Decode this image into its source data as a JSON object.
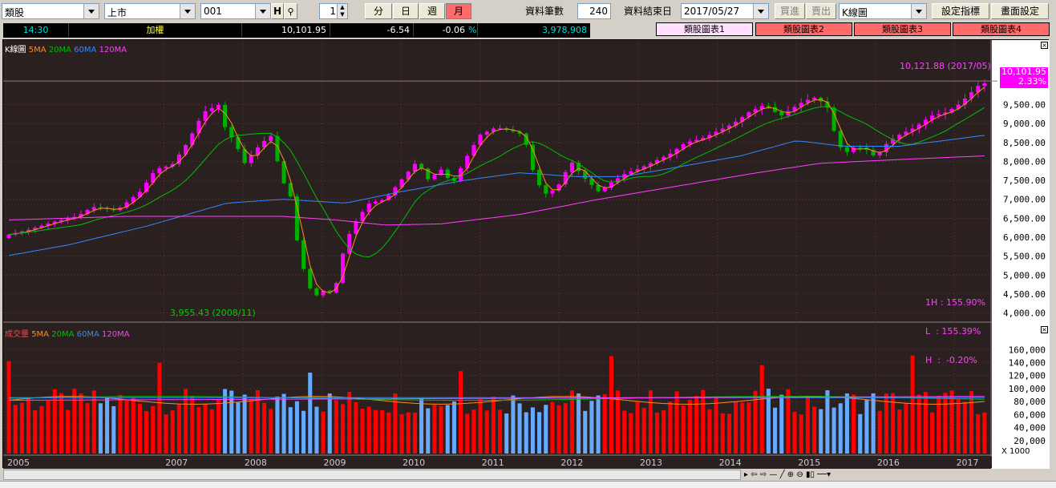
{
  "toolbar": {
    "category": "類股",
    "market": "上市",
    "code": "001",
    "h_btn": "H",
    "count": "1",
    "period_min": "分",
    "period_day": "日",
    "period_week": "週",
    "period_month": "月",
    "records_label": "資料筆數",
    "records_value": "240",
    "enddate_label": "資料結束日",
    "enddate_value": "2017/05/27",
    "buy_btn": "買進",
    "sell_btn": "賣出",
    "chart_type": "K線圖",
    "indicator_btn": "設定指標",
    "screen_btn": "畫面設定"
  },
  "quote": {
    "time": "14:30",
    "name": "加權",
    "price": "10,101.95",
    "change": "-6.54",
    "pct": "-0.06",
    "pct_sign": "%",
    "volume": "3,978,908"
  },
  "tabs": [
    "類股圖表1",
    "類股圖表2",
    "類股圖表3",
    "類股圖表4"
  ],
  "colors": {
    "up": "#ff00ff",
    "down": "#00b000",
    "ma5": "#ff8c1a",
    "ma20": "#00c000",
    "ma60": "#3388ff",
    "ma120": "#ff40ff",
    "vol_up": "#ff0000",
    "vol_down": "#66aaff"
  },
  "price_panel": {
    "legend": [
      "K線圖",
      "5MA",
      "20MA",
      "60MA",
      "120MA"
    ],
    "high_annot": "10,121.88 (2017/05)",
    "low_annot": "3,955.43 (2008/11)",
    "last_box": "10,101.95",
    "last_pct": "2.33%",
    "stats": [
      "1H : 155.90%",
      "L  : 155.39%",
      "H  :  -0.20%"
    ]
  },
  "volume_panel": {
    "legend": [
      "成交量",
      "5MA",
      "20MA",
      "60MA",
      "120MA"
    ],
    "unit": "X 1000"
  },
  "chart_data": {
    "type": "candlestick",
    "price_yticks": [
      4000,
      4500,
      5000,
      5500,
      6000,
      6500,
      7000,
      7500,
      8000,
      8500,
      9000,
      9500
    ],
    "price_ylim": [
      3800,
      10400
    ],
    "volume_yticks": [
      20000,
      40000,
      60000,
      80000,
      100000,
      120000,
      140000,
      160000
    ],
    "volume_ylim": [
      0,
      190000
    ],
    "x_years": [
      "2005",
      "2007",
      "2008",
      "2009",
      "2010",
      "2011",
      "2012",
      "2013",
      "2014",
      "2015",
      "2016",
      "2017"
    ],
    "year_x": [
      2005,
      2007,
      2008,
      2009,
      2010,
      2011,
      2012,
      2013,
      2014,
      2015,
      2016,
      2017
    ],
    "time_start": 2005.0,
    "time_end": 2017.42,
    "close_anchors": [
      [
        2005,
        6050
      ],
      [
        2005.3,
        6200
      ],
      [
        2005.6,
        6400
      ],
      [
        2005.9,
        6550
      ],
      [
        2006.1,
        6800
      ],
      [
        2006.4,
        6700
      ],
      [
        2006.7,
        7200
      ],
      [
        2006.9,
        7800
      ],
      [
        2007.1,
        7900
      ],
      [
        2007.3,
        8500
      ],
      [
        2007.5,
        9300
      ],
      [
        2007.7,
        9500
      ],
      [
        2007.8,
        8700
      ],
      [
        2007.9,
        8600
      ],
      [
        2008.0,
        7900
      ],
      [
        2008.2,
        8400
      ],
      [
        2008.35,
        8700
      ],
      [
        2008.5,
        7500
      ],
      [
        2008.6,
        7100
      ],
      [
        2008.7,
        5700
      ],
      [
        2008.8,
        4900
      ],
      [
        2008.9,
        4400
      ],
      [
        2009.0,
        4600
      ],
      [
        2009.15,
        4500
      ],
      [
        2009.3,
        5900
      ],
      [
        2009.45,
        6500
      ],
      [
        2009.6,
        6900
      ],
      [
        2009.8,
        7000
      ],
      [
        2010.0,
        7500
      ],
      [
        2010.2,
        8000
      ],
      [
        2010.35,
        7500
      ],
      [
        2010.5,
        7800
      ],
      [
        2010.65,
        7400
      ],
      [
        2010.85,
        8200
      ],
      [
        2011.0,
        8700
      ],
      [
        2011.2,
        8900
      ],
      [
        2011.4,
        8800
      ],
      [
        2011.55,
        8700
      ],
      [
        2011.7,
        7500
      ],
      [
        2011.85,
        7100
      ],
      [
        2012.0,
        7400
      ],
      [
        2012.15,
        8000
      ],
      [
        2012.3,
        7600
      ],
      [
        2012.5,
        7200
      ],
      [
        2012.7,
        7500
      ],
      [
        2012.85,
        7700
      ],
      [
        2013.0,
        7800
      ],
      [
        2013.2,
        8000
      ],
      [
        2013.4,
        8200
      ],
      [
        2013.6,
        8500
      ],
      [
        2013.8,
        8600
      ],
      [
        2014.0,
        8800
      ],
      [
        2014.2,
        9000
      ],
      [
        2014.4,
        9300
      ],
      [
        2014.6,
        9500
      ],
      [
        2014.8,
        9200
      ],
      [
        2014.95,
        9400
      ],
      [
        2015.1,
        9600
      ],
      [
        2015.25,
        9700
      ],
      [
        2015.4,
        9400
      ],
      [
        2015.5,
        8600
      ],
      [
        2015.6,
        8200
      ],
      [
        2015.75,
        8400
      ],
      [
        2015.9,
        8300
      ],
      [
        2016.0,
        8100
      ],
      [
        2016.15,
        8500
      ],
      [
        2016.3,
        8700
      ],
      [
        2016.5,
        8900
      ],
      [
        2016.7,
        9200
      ],
      [
        2016.9,
        9300
      ],
      [
        2017.05,
        9500
      ],
      [
        2017.2,
        9800
      ],
      [
        2017.3,
        10000
      ],
      [
        2017.42,
        10100
      ]
    ],
    "ma120_anchors": [
      [
        2005,
        6450
      ],
      [
        2006.5,
        6550
      ],
      [
        2008.5,
        6550
      ],
      [
        2009.2,
        6450
      ],
      [
        2009.8,
        6320
      ],
      [
        2010.5,
        6350
      ],
      [
        2011.5,
        6600
      ],
      [
        2012.5,
        7000
      ],
      [
        2013.5,
        7350
      ],
      [
        2014.5,
        7700
      ],
      [
        2015.3,
        7950
      ],
      [
        2016.3,
        8050
      ],
      [
        2017.42,
        8150
      ]
    ],
    "ma60_anchors": [
      [
        2005,
        5500
      ],
      [
        2005.8,
        5800
      ],
      [
        2006.8,
        6300
      ],
      [
        2007.8,
        6900
      ],
      [
        2008.5,
        7000
      ],
      [
        2009.3,
        6900
      ],
      [
        2010.0,
        7200
      ],
      [
        2010.8,
        7500
      ],
      [
        2011.5,
        7700
      ],
      [
        2012.2,
        7600
      ],
      [
        2012.8,
        7600
      ],
      [
        2013.5,
        7850
      ],
      [
        2014.3,
        8150
      ],
      [
        2015.0,
        8550
      ],
      [
        2015.6,
        8400
      ],
      [
        2016.3,
        8400
      ],
      [
        2017.42,
        8700
      ]
    ]
  }
}
